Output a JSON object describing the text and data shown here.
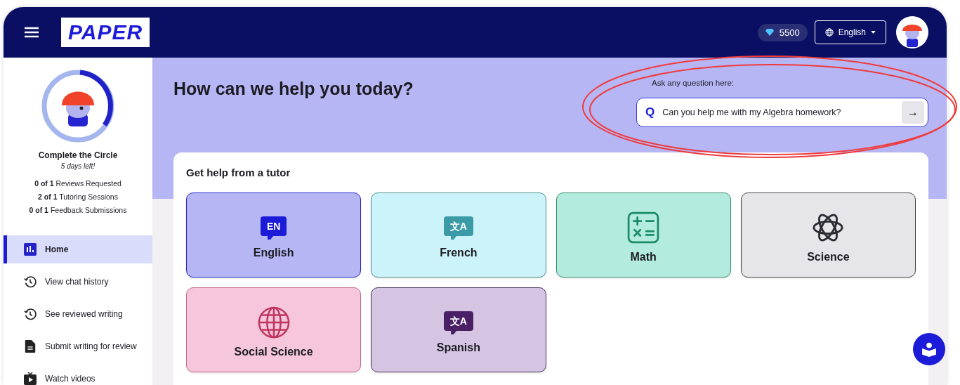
{
  "header": {
    "logo": "PAPER",
    "gems": "5500",
    "language": "English"
  },
  "sidebar": {
    "challenge_title": "Complete the Circle",
    "days_left": "5 days left!",
    "stats": [
      "**0 of 1** Reviews Requested",
      "**2 of 1** Tutoring Sessions",
      "**0 of 1** Feedback Submissions"
    ],
    "items": [
      {
        "label": "Home",
        "kind": "chart",
        "selected": true
      },
      {
        "label": "View chat history",
        "kind": "history",
        "selected": false
      },
      {
        "label": "See reviewed writing",
        "kind": "history",
        "selected": false
      },
      {
        "label": "Submit writing for review",
        "kind": "document",
        "selected": false
      },
      {
        "label": "Watch videos",
        "kind": "video",
        "selected": false
      }
    ]
  },
  "main": {
    "heading": "How can we help you today?",
    "ask_label": "Ask any question here:",
    "ask_icon": "Q",
    "ask_value": "Can you help me with my Algebra homework?",
    "submit_icon": "→"
  },
  "tutor": {
    "title": "Get help from a tutor",
    "subjects": [
      {
        "label": "English",
        "kind": "bubble",
        "icon_text": "EN",
        "color": "#b6b6f5"
      },
      {
        "label": "French",
        "kind": "bubble",
        "icon_text": "文A",
        "color": "#cdf3fa"
      },
      {
        "label": "Math",
        "kind": "calculator",
        "color": "#b3ecdf"
      },
      {
        "label": "Science",
        "kind": "atom",
        "color": "#e6e6e8"
      },
      {
        "label": "Social Science",
        "kind": "globe",
        "color": "#f5c6dc"
      },
      {
        "label": "Spanish",
        "kind": "bubble",
        "icon_text": "文A",
        "color": "#d5c5e2"
      }
    ]
  }
}
